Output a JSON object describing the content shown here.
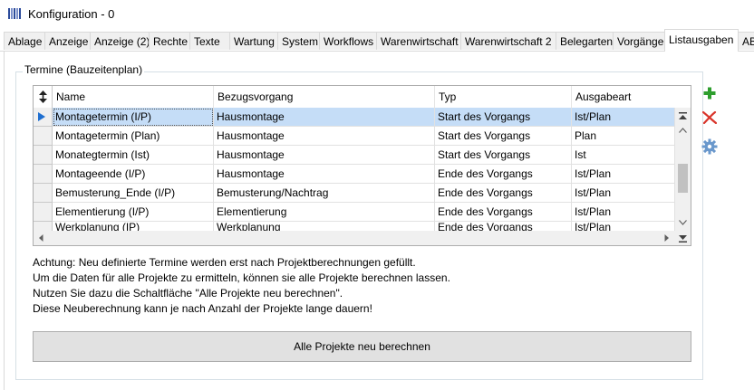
{
  "window": {
    "title": "Konfiguration - 0"
  },
  "tabs": [
    {
      "label": "Ablage"
    },
    {
      "label": "Anzeige"
    },
    {
      "label": "Anzeige (2)"
    },
    {
      "label": "Rechte"
    },
    {
      "label": "Texte"
    },
    {
      "label": "Wartung"
    },
    {
      "label": "System"
    },
    {
      "label": "Workflows"
    },
    {
      "label": "Warenwirtschaft"
    },
    {
      "label": "Warenwirtschaft 2"
    },
    {
      "label": "Belegarten"
    },
    {
      "label": "Vorgänge"
    },
    {
      "label": "Listausgaben",
      "active": true
    },
    {
      "label": "AB"
    }
  ],
  "group": {
    "title": "Termine (Bauzeitenplan)"
  },
  "grid": {
    "columns": [
      "Name",
      "Bezugsvorgang",
      "Typ",
      "Ausgabeart"
    ],
    "rows": [
      {
        "name": "Montagetermin (I/P)",
        "bezug": "Hausmontage",
        "typ": "Start des Vorgangs",
        "art": "Ist/Plan",
        "selected": true
      },
      {
        "name": "Montagetermin (Plan)",
        "bezug": "Hausmontage",
        "typ": "Start des Vorgangs",
        "art": "Plan"
      },
      {
        "name": "Monategtermin (Ist)",
        "bezug": "Hausmontage",
        "typ": "Start des Vorgangs",
        "art": "Ist"
      },
      {
        "name": "Montageende (I/P)",
        "bezug": "Hausmontage",
        "typ": "Ende des Vorgangs",
        "art": "Ist/Plan"
      },
      {
        "name": "Bemusterung_Ende (I/P)",
        "bezug": "Bemusterung/Nachtrag",
        "typ": "Ende des Vorgangs",
        "art": "Ist/Plan"
      },
      {
        "name": "Elementierung (I/P)",
        "bezug": "Elementierung",
        "typ": "Ende des Vorgangs",
        "art": "Ist/Plan"
      },
      {
        "name": "Werkplanung (IP)",
        "bezug": "Werkplanung",
        "typ": "Ende des Vorgangs",
        "art": "Ist/Plan"
      }
    ]
  },
  "side_buttons": [
    {
      "icon": "plus-icon",
      "color": "#2e9e2e"
    },
    {
      "icon": "delete-x-icon",
      "color": "#d9352b"
    },
    {
      "icon": "gear-icon",
      "color": "#5b8fc7"
    }
  ],
  "notes": [
    "Achtung: Neu definierte Termine werden erst nach Projektberechnungen gefüllt.",
    "Um die Daten für alle Projekte zu ermitteln, können sie alle Projekte berechnen lassen.",
    "Nutzen Sie dazu die Schaltfläche \"Alle Projekte neu berechnen\".",
    "Diese Neuberechnung kann je nach Anzahl der Projekte lange dauern!"
  ],
  "recalc_button": {
    "label": "Alle Projekte neu berechnen"
  }
}
